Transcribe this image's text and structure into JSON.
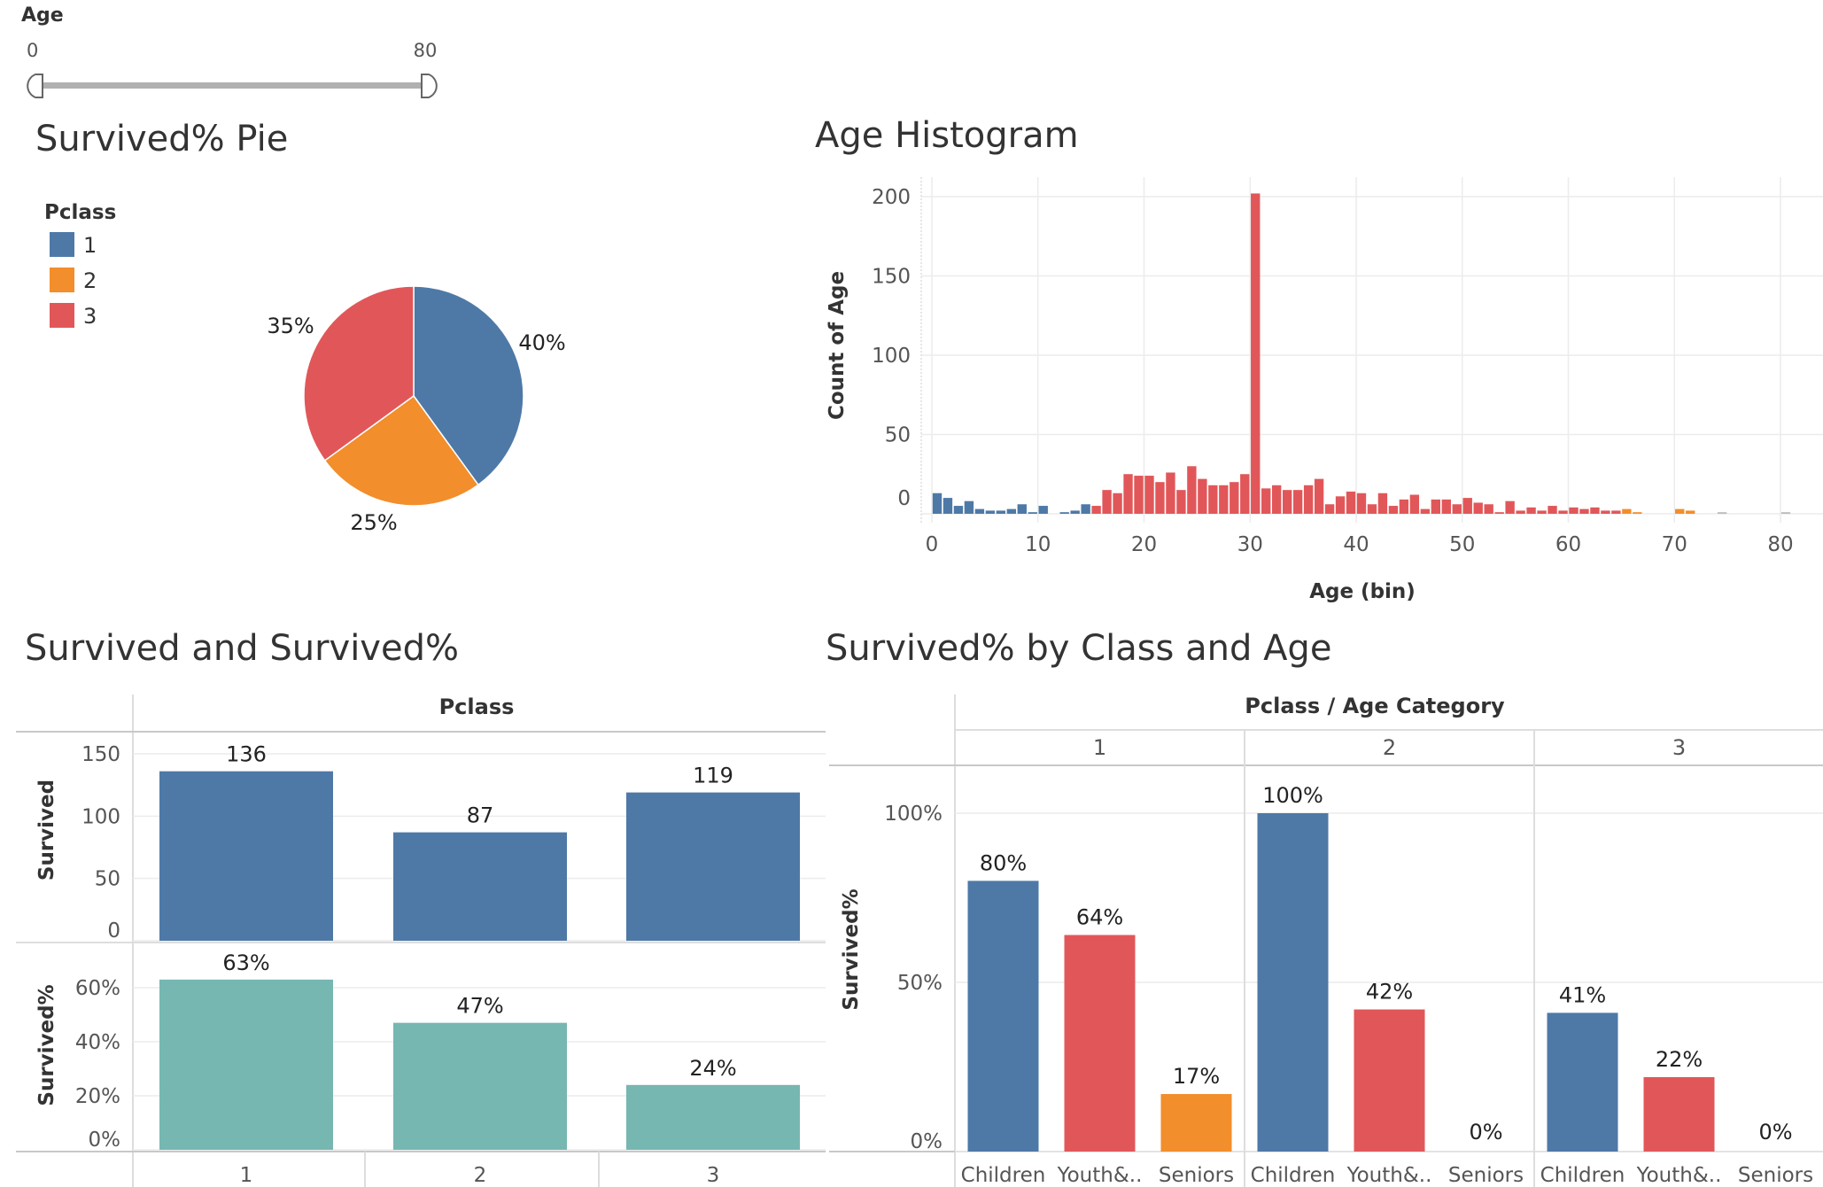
{
  "colors": {
    "class1": "#4e79a7",
    "class2": "#f28e2b",
    "class3": "#e15759",
    "teal": "#76b7b2",
    "slider_track": "#b0b0b0"
  },
  "age_filter": {
    "label": "Age",
    "min_label": "0",
    "max_label": "80",
    "min": 0,
    "max": 80
  },
  "chart_data": [
    {
      "type": "pie",
      "title": "Survived% Pie",
      "legend_title": "Pclass",
      "legend_position": "top-left",
      "categories": [
        "1",
        "2",
        "3"
      ],
      "values": [
        40,
        25,
        35
      ],
      "labels": [
        "40%",
        "25%",
        "35%"
      ]
    },
    {
      "type": "bar",
      "title": "Age Histogram",
      "xlabel": "Age (bin)",
      "ylabel": "Count of Age",
      "xlim": [
        0,
        80
      ],
      "ylim": [
        0,
        200
      ],
      "x_ticks": [
        "0",
        "10",
        "20",
        "30",
        "40",
        "50",
        "60",
        "70",
        "80"
      ],
      "y_ticks": [
        "0",
        "50",
        "100",
        "150",
        "200"
      ],
      "grid": true,
      "bars": [
        {
          "x": 0,
          "y": 13,
          "c": 1
        },
        {
          "x": 1,
          "y": 10,
          "c": 1
        },
        {
          "x": 2,
          "y": 5,
          "c": 1
        },
        {
          "x": 3,
          "y": 8,
          "c": 1
        },
        {
          "x": 4,
          "y": 3,
          "c": 1
        },
        {
          "x": 5,
          "y": 2,
          "c": 1
        },
        {
          "x": 6,
          "y": 2,
          "c": 1
        },
        {
          "x": 7,
          "y": 3,
          "c": 1
        },
        {
          "x": 8,
          "y": 6,
          "c": 1
        },
        {
          "x": 9,
          "y": 1,
          "c": 1
        },
        {
          "x": 10,
          "y": 5,
          "c": 1
        },
        {
          "x": 12,
          "y": 1,
          "c": 1
        },
        {
          "x": 13,
          "y": 2,
          "c": 1
        },
        {
          "x": 14,
          "y": 6,
          "c": 1
        },
        {
          "x": 15,
          "y": 5,
          "c": 3
        },
        {
          "x": 16,
          "y": 15,
          "c": 3
        },
        {
          "x": 17,
          "y": 13,
          "c": 3
        },
        {
          "x": 18,
          "y": 25,
          "c": 3
        },
        {
          "x": 19,
          "y": 24,
          "c": 3
        },
        {
          "x": 20,
          "y": 24,
          "c": 3
        },
        {
          "x": 21,
          "y": 20,
          "c": 3
        },
        {
          "x": 22,
          "y": 26,
          "c": 3
        },
        {
          "x": 23,
          "y": 15,
          "c": 3
        },
        {
          "x": 24,
          "y": 30,
          "c": 3
        },
        {
          "x": 25,
          "y": 22,
          "c": 3
        },
        {
          "x": 26,
          "y": 18,
          "c": 3
        },
        {
          "x": 27,
          "y": 18,
          "c": 3
        },
        {
          "x": 28,
          "y": 20,
          "c": 3
        },
        {
          "x": 29,
          "y": 25,
          "c": 3
        },
        {
          "x": 30,
          "y": 202,
          "c": 3
        },
        {
          "x": 31,
          "y": 16,
          "c": 3
        },
        {
          "x": 32,
          "y": 18,
          "c": 3
        },
        {
          "x": 33,
          "y": 15,
          "c": 3
        },
        {
          "x": 34,
          "y": 15,
          "c": 3
        },
        {
          "x": 35,
          "y": 18,
          "c": 3
        },
        {
          "x": 36,
          "y": 22,
          "c": 3
        },
        {
          "x": 37,
          "y": 6,
          "c": 3
        },
        {
          "x": 38,
          "y": 11,
          "c": 3
        },
        {
          "x": 39,
          "y": 14,
          "c": 3
        },
        {
          "x": 40,
          "y": 13,
          "c": 3
        },
        {
          "x": 41,
          "y": 6,
          "c": 3
        },
        {
          "x": 42,
          "y": 13,
          "c": 3
        },
        {
          "x": 43,
          "y": 5,
          "c": 3
        },
        {
          "x": 44,
          "y": 9,
          "c": 3
        },
        {
          "x": 45,
          "y": 12,
          "c": 3
        },
        {
          "x": 46,
          "y": 3,
          "c": 3
        },
        {
          "x": 47,
          "y": 9,
          "c": 3
        },
        {
          "x": 48,
          "y": 9,
          "c": 3
        },
        {
          "x": 49,
          "y": 6,
          "c": 3
        },
        {
          "x": 50,
          "y": 10,
          "c": 3
        },
        {
          "x": 51,
          "y": 7,
          "c": 3
        },
        {
          "x": 52,
          "y": 6,
          "c": 3
        },
        {
          "x": 53,
          "y": 1,
          "c": 3
        },
        {
          "x": 54,
          "y": 8,
          "c": 3
        },
        {
          "x": 55,
          "y": 2,
          "c": 3
        },
        {
          "x": 56,
          "y": 4,
          "c": 3
        },
        {
          "x": 57,
          "y": 2,
          "c": 3
        },
        {
          "x": 58,
          "y": 5,
          "c": 3
        },
        {
          "x": 59,
          "y": 2,
          "c": 3
        },
        {
          "x": 60,
          "y": 4,
          "c": 3
        },
        {
          "x": 61,
          "y": 3,
          "c": 3
        },
        {
          "x": 62,
          "y": 4,
          "c": 3
        },
        {
          "x": 63,
          "y": 2,
          "c": 3
        },
        {
          "x": 64,
          "y": 2,
          "c": 3
        },
        {
          "x": 65,
          "y": 3,
          "c": 2
        },
        {
          "x": 66,
          "y": 1,
          "c": 2
        },
        {
          "x": 70,
          "y": 3,
          "c": 2
        },
        {
          "x": 71,
          "y": 2,
          "c": 2
        },
        {
          "x": 74,
          "y": 1,
          "c": 0
        },
        {
          "x": 80,
          "y": 1,
          "c": 0
        }
      ]
    },
    {
      "type": "bar",
      "title": "Survived and Survived%",
      "column_header": "Pclass",
      "categories": [
        "1",
        "2",
        "3"
      ],
      "series": [
        {
          "name": "Survived",
          "values": [
            136,
            87,
            119
          ],
          "labels": [
            "136",
            "87",
            "119"
          ],
          "ylim": [
            0,
            150
          ],
          "y_ticks": [
            "0",
            "50",
            "100",
            "150"
          ]
        },
        {
          "name": "Survived%",
          "values": [
            63,
            47,
            24
          ],
          "labels": [
            "63%",
            "47%",
            "24%"
          ],
          "ylim": [
            0,
            60
          ],
          "y_ticks": [
            "0%",
            "20%",
            "40%",
            "60%"
          ]
        }
      ]
    },
    {
      "type": "bar",
      "title": "Survived% by Class and Age",
      "column_header": "Pclass / Age Category",
      "ylabel": "Survived%",
      "ylim": [
        0,
        100
      ],
      "y_ticks": [
        "0%",
        "50%",
        "100%"
      ],
      "groups": [
        {
          "name": "1",
          "categories": [
            "Children",
            "Youth&..",
            "Seniors"
          ],
          "values": [
            80,
            64,
            17
          ],
          "labels": [
            "80%",
            "64%",
            "17%"
          ],
          "colors": [
            1,
            3,
            2
          ]
        },
        {
          "name": "2",
          "categories": [
            "Children",
            "Youth&..",
            "Seniors"
          ],
          "values": [
            100,
            42,
            0
          ],
          "labels": [
            "100%",
            "42%",
            "0%"
          ],
          "colors": [
            1,
            3,
            2
          ]
        },
        {
          "name": "3",
          "categories": [
            "Children",
            "Youth&..",
            "Seniors"
          ],
          "values": [
            41,
            22,
            0
          ],
          "labels": [
            "41%",
            "22%",
            "0%"
          ],
          "colors": [
            1,
            3,
            2
          ]
        }
      ]
    }
  ]
}
